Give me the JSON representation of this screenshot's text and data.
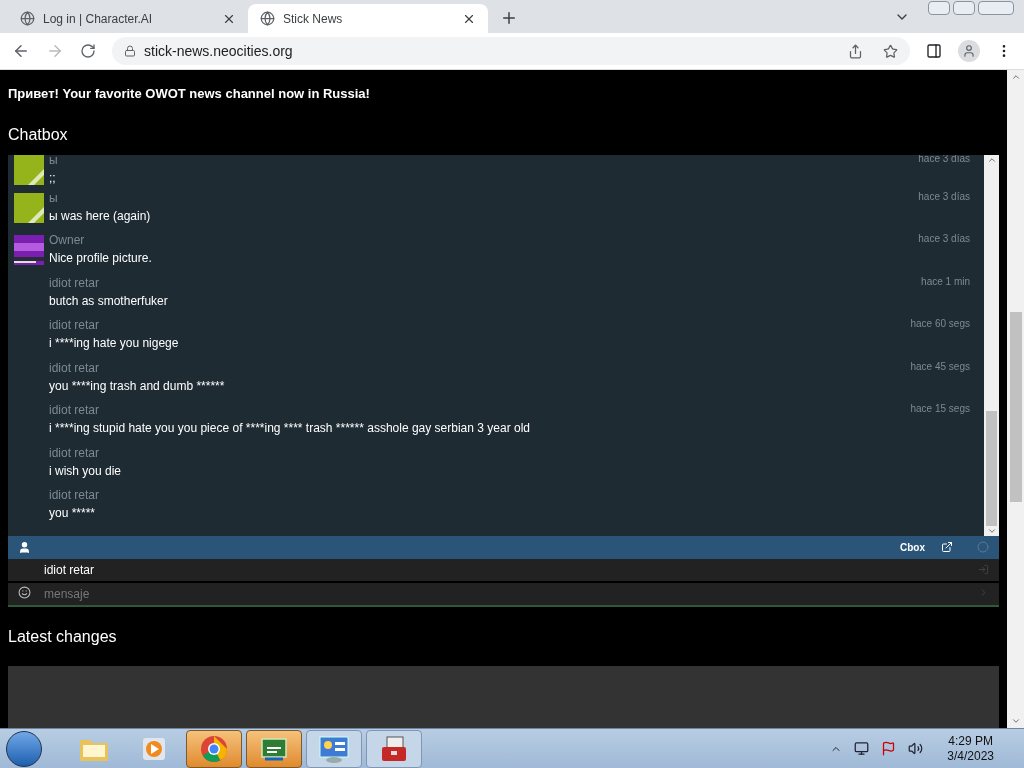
{
  "browser": {
    "tabs": [
      {
        "title": "Log in | Character.AI",
        "selected": false
      },
      {
        "title": "Stick News",
        "selected": true
      }
    ],
    "url": "stick-news.neocities.org"
  },
  "page": {
    "banner": "Привет! Your favorite OWOT news channel now in Russia!",
    "chatbox_heading": "Chatbox",
    "messages": [
      {
        "kind": "green",
        "name": "ы",
        "text": ";;",
        "time": "hace 3 días"
      },
      {
        "kind": "green",
        "name": "ы",
        "text": "ы was here (again)",
        "time": "hace 3 días"
      },
      {
        "kind": "purple",
        "name": "Owner",
        "text": "Nice profile picture.",
        "time": "hace 3 días"
      },
      {
        "kind": "plain",
        "name": "idiot retar",
        "text": "butch as smotherfuker",
        "time": "hace 1 min"
      },
      {
        "kind": "plain",
        "name": "idiot retar",
        "text": "i ****ing hate you nigege",
        "time": "hace 60 segs"
      },
      {
        "kind": "plain",
        "name": "idiot retar",
        "text": "you ****ing trash and dumb ******",
        "time": "hace 45 segs"
      },
      {
        "kind": "plain",
        "name": "idiot retar",
        "text": "i ****ing stupid hate you you piece of ****ing **** trash ****** asshole gay serbian 3 year old",
        "time": "hace 15 segs"
      },
      {
        "kind": "plain",
        "name": "idiot retar",
        "text": "i wish you die"
      },
      {
        "kind": "plain",
        "name": "idiot retar",
        "text": "you *****"
      }
    ],
    "toolbar_label": "Cbox",
    "username": "idiot retar",
    "message_placeholder": "mensaje",
    "latest_heading": "Latest changes"
  },
  "taskbar": {
    "apps": [
      {
        "kind": "folder",
        "active": false
      },
      {
        "kind": "media",
        "active": false
      },
      {
        "kind": "chrome",
        "active": true
      },
      {
        "kind": "csharp",
        "active": true
      },
      {
        "kind": "panel",
        "active": false
      },
      {
        "kind": "toolbox",
        "active": false
      }
    ],
    "time": "4:29 PM",
    "date": "3/4/2023"
  }
}
